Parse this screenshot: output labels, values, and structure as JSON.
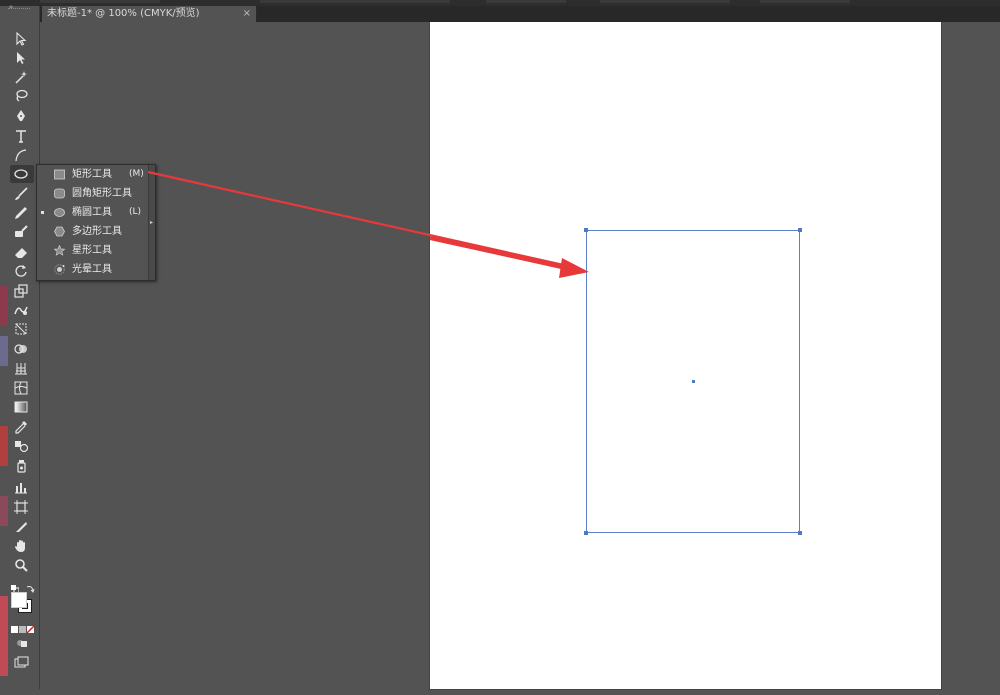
{
  "document_tab": {
    "title": "未标题-1* @ 100% (CMYK/预览)",
    "close_label": "×"
  },
  "toolbar": {
    "collapse_label": "»",
    "tools": [
      {
        "name": "selection-tool-icon"
      },
      {
        "name": "direct-selection-tool-icon"
      },
      {
        "name": "magic-wand-tool-icon"
      },
      {
        "name": "lasso-tool-icon"
      },
      {
        "name": "pen-tool-icon"
      },
      {
        "name": "type-tool-icon"
      },
      {
        "name": "line-segment-tool-icon"
      },
      {
        "name": "ellipse-tool-icon"
      },
      {
        "name": "paintbrush-tool-icon"
      },
      {
        "name": "pencil-tool-icon"
      },
      {
        "name": "blob-brush-tool-icon"
      },
      {
        "name": "eraser-tool-icon"
      },
      {
        "name": "rotate-tool-icon"
      },
      {
        "name": "scale-tool-icon"
      },
      {
        "name": "warp-tool-icon"
      },
      {
        "name": "free-transform-tool-icon"
      },
      {
        "name": "shape-builder-tool-icon"
      },
      {
        "name": "perspective-grid-tool-icon"
      },
      {
        "name": "mesh-tool-icon"
      },
      {
        "name": "gradient-tool-icon"
      },
      {
        "name": "eyedropper-tool-icon"
      },
      {
        "name": "blend-tool-icon"
      },
      {
        "name": "symbol-sprayer-tool-icon"
      },
      {
        "name": "column-graph-tool-icon"
      },
      {
        "name": "artboard-tool-icon"
      },
      {
        "name": "slice-tool-icon"
      },
      {
        "name": "hand-tool-icon"
      },
      {
        "name": "zoom-tool-icon"
      }
    ]
  },
  "shape_flyout": {
    "items": [
      {
        "label": "矩形工具",
        "shortcut": "(M)",
        "icon": "rectangle-icon",
        "selected": false
      },
      {
        "label": "圆角矩形工具",
        "shortcut": "",
        "icon": "rounded-rectangle-icon",
        "selected": false
      },
      {
        "label": "椭圆工具",
        "shortcut": "(L)",
        "icon": "ellipse-icon",
        "selected": true
      },
      {
        "label": "多边形工具",
        "shortcut": "",
        "icon": "polygon-icon",
        "selected": false
      },
      {
        "label": "星形工具",
        "shortcut": "",
        "icon": "star-icon",
        "selected": false
      },
      {
        "label": "光晕工具",
        "shortcut": "",
        "icon": "flare-icon",
        "selected": false
      }
    ]
  },
  "colors": {
    "workspace": "#535353",
    "artboard": "#ffffff",
    "selection": "#5b7fc9",
    "annotation_arrow": "#e8393a",
    "fill": "#ffffff",
    "stroke": "#1e1e1e"
  }
}
